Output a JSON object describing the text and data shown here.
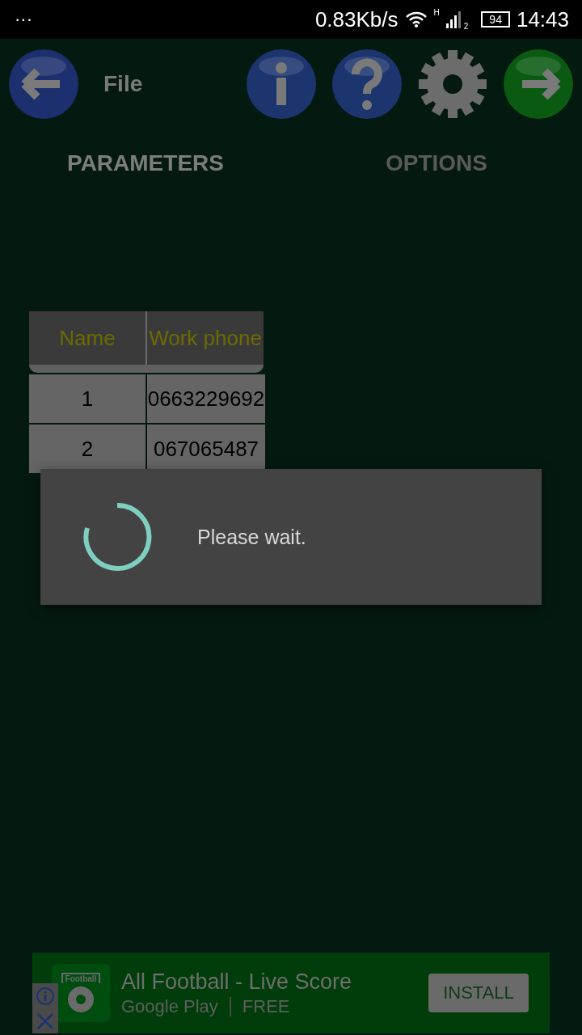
{
  "status_bar": {
    "menu": "···",
    "speed": "0.83Kb/s",
    "network_type": "H",
    "sim": "2",
    "battery": "94",
    "time": "14:43"
  },
  "toolbar": {
    "title": "File"
  },
  "tabs": [
    {
      "label": "PARAMETERS",
      "selected": true
    },
    {
      "label": "OPTIONS",
      "selected": false
    }
  ],
  "table": {
    "columns": [
      "Name",
      "Work phone"
    ],
    "rows": [
      {
        "name": "1",
        "work_phone": "0663229692"
      },
      {
        "name": "2",
        "work_phone": "067065487"
      }
    ]
  },
  "dialog": {
    "message": "Please wait."
  },
  "ad": {
    "app_badge": "Football",
    "title": "All Football - Live Score",
    "store": "Google Play",
    "price": "FREE",
    "button": "INSTALL"
  }
}
